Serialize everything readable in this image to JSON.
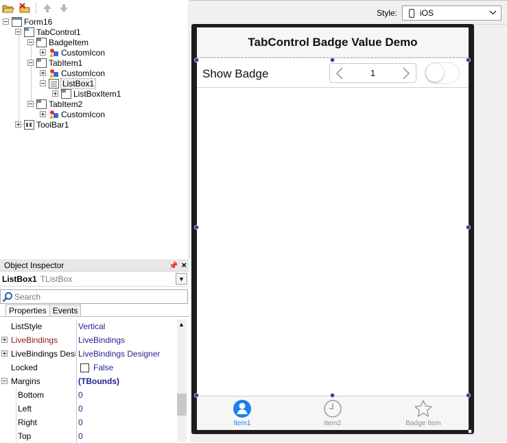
{
  "structure": {
    "nodes": [
      {
        "label": "Form16"
      },
      {
        "label": "TabControl1"
      },
      {
        "label": "BadgeItem"
      },
      {
        "label": "CustomIcon"
      },
      {
        "label": "TabItem1"
      },
      {
        "label": "CustomIcon"
      },
      {
        "label": "ListBox1"
      },
      {
        "label": "ListBoxItem1"
      },
      {
        "label": "TabItem2"
      },
      {
        "label": "CustomIcon"
      },
      {
        "label": "ToolBar1"
      }
    ]
  },
  "inspector": {
    "title": "Object Inspector",
    "object_name": "ListBox1",
    "object_class": "TListBox",
    "search_placeholder": "Search",
    "tabs": [
      "Properties",
      "Events"
    ],
    "properties": [
      {
        "name": "ListStyle",
        "value": "Vertical"
      },
      {
        "name": "LiveBindings",
        "value": "LiveBindings"
      },
      {
        "name": "LiveBindings Designer",
        "value": "LiveBindings Designer"
      },
      {
        "name": "Locked",
        "value": "False"
      },
      {
        "name": "Margins",
        "value": "(TBounds)"
      },
      {
        "name": "Bottom",
        "value": "0"
      },
      {
        "name": "Left",
        "value": "0"
      },
      {
        "name": "Right",
        "value": "0"
      },
      {
        "name": "Top",
        "value": "0"
      }
    ]
  },
  "designer": {
    "style_label": "Style:",
    "style_value": "iOS",
    "form_title": "TabControl Badge Value Demo",
    "row_label": "Show Badge",
    "stepper_value": "1",
    "switch_on": false,
    "tabs": [
      {
        "label": "Item1",
        "icon": "contacts-icon"
      },
      {
        "label": "Item2",
        "icon": "history-icon"
      },
      {
        "label": "Badge Item",
        "icon": "star-icon"
      }
    ]
  },
  "colors": {
    "accent": "#1a7ff0",
    "prop_value": "#1f1f8f",
    "prop_name_highlight": "#8b1a1a",
    "selection_handle": "#2b3a8c"
  }
}
